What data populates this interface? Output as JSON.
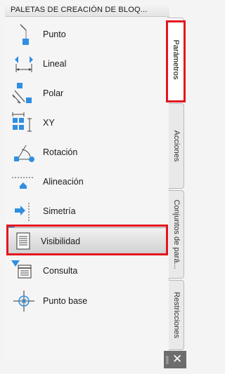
{
  "title": "PALETAS DE CREACIÓN DE BLOQ...",
  "items": [
    {
      "label": "Punto",
      "icon": "point-parameter-icon"
    },
    {
      "label": "Lineal",
      "icon": "linear-parameter-icon"
    },
    {
      "label": "Polar",
      "icon": "polar-parameter-icon"
    },
    {
      "label": "XY",
      "icon": "xy-parameter-icon"
    },
    {
      "label": "Rotación",
      "icon": "rotation-parameter-icon"
    },
    {
      "label": "Alineación",
      "icon": "alignment-parameter-icon"
    },
    {
      "label": "Simetría",
      "icon": "flip-parameter-icon"
    },
    {
      "label": "Visibilidad",
      "icon": "visibility-parameter-icon"
    },
    {
      "label": "Consulta",
      "icon": "lookup-parameter-icon"
    },
    {
      "label": "Punto base",
      "icon": "base-point-parameter-icon"
    }
  ],
  "tabs": [
    {
      "label": "Parámetros",
      "active": true
    },
    {
      "label": "Acciones",
      "active": false
    },
    {
      "label": "Conjuntos de pará...",
      "active": false
    },
    {
      "label": "Restricciones",
      "active": false
    }
  ],
  "close_glyph": "✕",
  "colors": {
    "accent_blue": "#2f8fe0",
    "highlight_red": "#e4141e",
    "selected_bg": "#cfcfcf"
  }
}
